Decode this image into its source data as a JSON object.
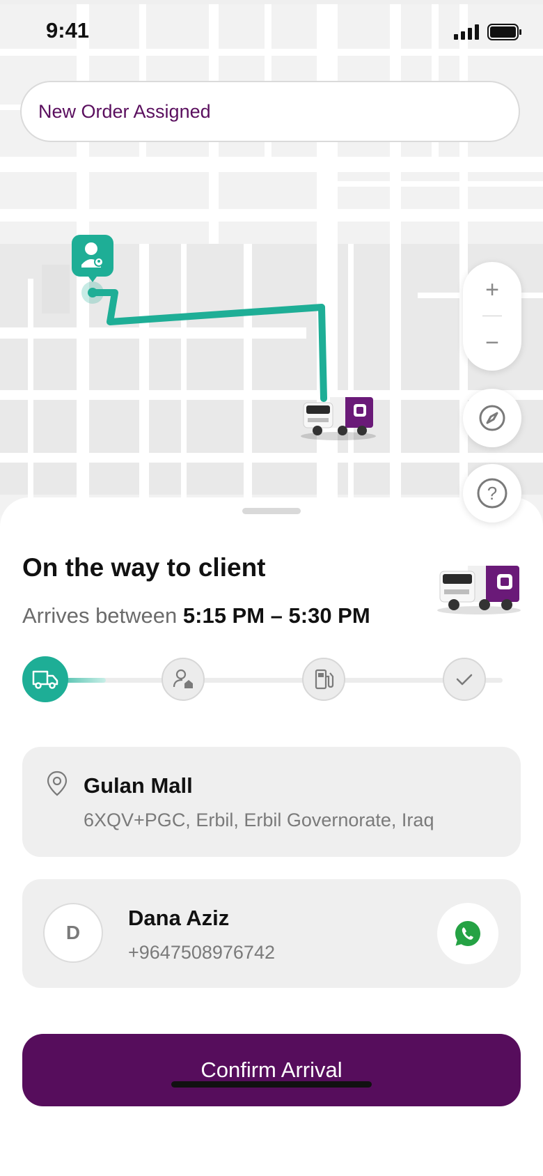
{
  "status_bar": {
    "time": "9:41"
  },
  "banner": {
    "text": "New Order Assigned"
  },
  "map_controls": {
    "zoom_in": "+",
    "zoom_out": "−",
    "help": "?"
  },
  "sheet": {
    "title": "On the way to client",
    "arrive_prefix": "Arrives between ",
    "arrive_window": "5:15 PM – 5:30 PM"
  },
  "progress": {
    "current_step": 1,
    "steps": [
      "truck-icon",
      "client-home-icon",
      "fuel-pump-icon",
      "check-icon"
    ]
  },
  "location": {
    "name": "Gulan Mall",
    "address": "6XQV+PGC, Erbil, Erbil Governorate, Iraq"
  },
  "contact": {
    "initial": "D",
    "name": "Dana Aziz",
    "phone": "+9647508976742"
  },
  "actions": {
    "confirm_label": "Confirm Arrival"
  },
  "colors": {
    "brand_purple": "#560d5c",
    "route_teal": "#1eae96",
    "banner_text": "#5a0f5e",
    "whatsapp": "#25a244"
  }
}
